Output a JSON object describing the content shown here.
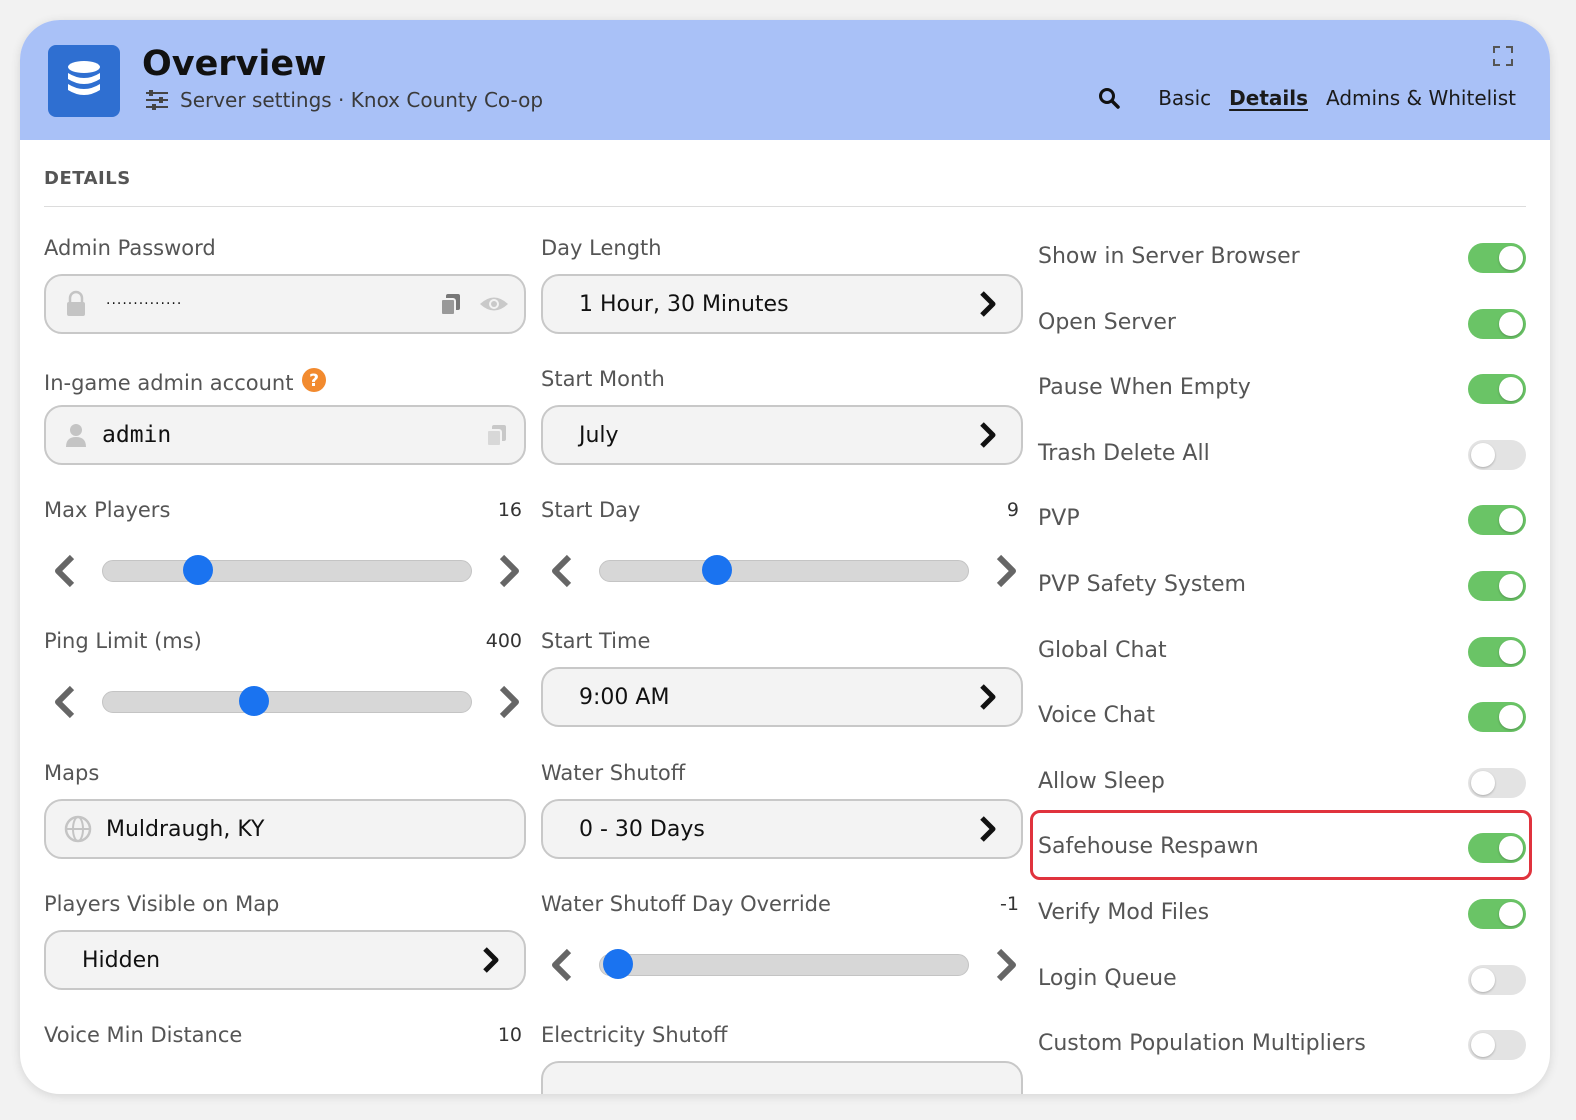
{
  "header": {
    "title": "Overview",
    "subtitle": "Server settings · Knox County Co-op",
    "tabs": [
      {
        "label": "Basic",
        "active": false
      },
      {
        "label": "Details",
        "active": true
      },
      {
        "label": "Admins & Whitelist",
        "active": false
      }
    ]
  },
  "section_title": "DETAILS",
  "col1": {
    "admin_password": {
      "label": "Admin Password",
      "value": "··············"
    },
    "ingame_admin": {
      "label": "In-game admin account",
      "value": "admin"
    },
    "max_players": {
      "label": "Max Players",
      "value": "16",
      "fraction": 0.26
    },
    "ping_limit": {
      "label": "Ping Limit (ms)",
      "value": "400",
      "fraction": 0.41
    },
    "maps": {
      "label": "Maps",
      "value": "Muldraugh, KY"
    },
    "players_visible": {
      "label": "Players Visible on Map",
      "value": "Hidden"
    },
    "voice_min_distance": {
      "label": "Voice Min Distance",
      "value": "10"
    }
  },
  "col2": {
    "day_length": {
      "label": "Day Length",
      "value": "1 Hour, 30 Minutes"
    },
    "start_month": {
      "label": "Start Month",
      "value": "July"
    },
    "start_day": {
      "label": "Start Day",
      "value": "9",
      "fraction": 0.32
    },
    "start_time": {
      "label": "Start Time",
      "value": "9:00 AM"
    },
    "water_shutoff": {
      "label": "Water Shutoff",
      "value": "0 - 30 Days"
    },
    "water_override": {
      "label": "Water Shutoff Day Override",
      "value": "-1",
      "fraction": 0.05
    },
    "electricity_shutoff": {
      "label": "Electricity Shutoff"
    }
  },
  "toggles": [
    {
      "label": "Show in Server Browser",
      "on": true
    },
    {
      "label": "Open Server",
      "on": true
    },
    {
      "label": "Pause When Empty",
      "on": true
    },
    {
      "label": "Trash Delete All",
      "on": false
    },
    {
      "label": "PVP",
      "on": true
    },
    {
      "label": "PVP Safety System",
      "on": true
    },
    {
      "label": "Global Chat",
      "on": true
    },
    {
      "label": "Voice Chat",
      "on": true
    },
    {
      "label": "Allow Sleep",
      "on": false
    },
    {
      "label": "Safehouse Respawn",
      "on": true
    },
    {
      "label": "Verify Mod Files",
      "on": true
    },
    {
      "label": "Login Queue",
      "on": false
    },
    {
      "label": "Custom Population Multipliers",
      "on": false
    }
  ],
  "highlighted_toggle": "Safehouse Respawn",
  "colors": {
    "accent": "#1a73f0",
    "header_bg": "#a9c1f7",
    "toggle_on": "#6ac466",
    "highlight": "#e0333d"
  }
}
